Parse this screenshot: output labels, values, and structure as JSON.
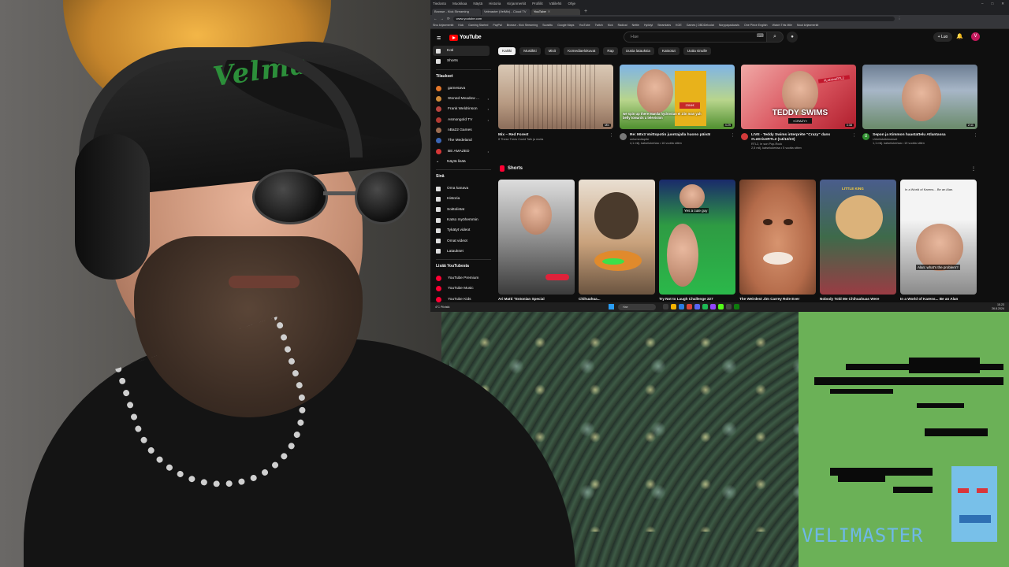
{
  "browser": {
    "menubar": [
      "Tiedosto",
      "Muokkaa",
      "Näytä",
      "Historia",
      "Kirjanmerkit",
      "Profiilit",
      "Välilehti",
      "Ohje"
    ],
    "tabs": [
      {
        "label": "Browse - Kick Streaming",
        "active": false
      },
      {
        "label": "Velmaster (VelMix) - Cloud TV",
        "active": false
      },
      {
        "label": "YouTube",
        "active": true
      }
    ],
    "new_tab": "+",
    "url": "www.youtube.com",
    "bookmarks": [
      "Sivu kirjanmerkit",
      "Kick",
      "Gaming Started",
      "PayPal",
      "Browse - Kick Streaming",
      "Suosittu",
      "Google Maps",
      "YouTube",
      "Twitch",
      "Kick",
      "Radical",
      "Nettie",
      "Hyödyt",
      "Steamlabs",
      "KOE",
      "Games | DBDDelcolat",
      "Norppapadcasts",
      "One Piece English",
      "Watch This Mile",
      "Muut kirjanmerkit"
    ]
  },
  "youtube": {
    "logo_text": "YouTube",
    "search_placeholder": "Hae",
    "create_label": "Luo",
    "avatar_letter": "V",
    "sidebar": {
      "main": [
        {
          "label": "Koti",
          "active": true
        },
        {
          "label": "Shorts",
          "active": false
        }
      ],
      "subscriptions_title": "Tilaukset",
      "subscriptions": [
        {
          "label": "gamesava",
          "color": "#e4772a"
        },
        {
          "label": "Stoned Meadow ...",
          "color": "#d08b3a"
        },
        {
          "label": "Frank Weldrinson",
          "color": "#b9453f"
        },
        {
          "label": "Asmongold TV",
          "color": "#b23a33"
        },
        {
          "label": "nBa22 Games",
          "color": "#9d6d52"
        },
        {
          "label": "The Medeland",
          "color": "#3b65b3"
        },
        {
          "label": "BE AMAZED",
          "color": "#d63737"
        }
      ],
      "show_more": "Näytä lisää",
      "you_title": "Sinä",
      "you": [
        {
          "label": "Oma kanava"
        },
        {
          "label": "Historia"
        },
        {
          "label": "Soittolistat"
        },
        {
          "label": "Katso myöhemmin"
        },
        {
          "label": "Tykätyt videot"
        },
        {
          "label": "Omat videot"
        },
        {
          "label": "Lataukset"
        }
      ],
      "more_title": "Lisää YouTubesta",
      "more": [
        {
          "label": "YouTube Premium",
          "color": "#ff0033"
        },
        {
          "label": "YouTube Music",
          "color": "#ff0033"
        },
        {
          "label": "YouTube Kids",
          "color": "#ff0033"
        }
      ]
    },
    "chips": [
      {
        "label": "Kaikki",
        "active": true
      },
      {
        "label": "Musiikki",
        "active": false
      },
      {
        "label": "Mixit",
        "active": false
      },
      {
        "label": "Komediaelokuvat",
        "active": false
      },
      {
        "label": "Rap",
        "active": false
      },
      {
        "label": "Uusia latauksia",
        "active": false
      },
      {
        "label": "Katsotut",
        "active": false
      },
      {
        "label": "Uutta sinulle",
        "active": false
      }
    ],
    "videos": [
      {
        "title": "Mix – Red Forest",
        "channel": "If These Trees Could Talk ja muita",
        "stats": "",
        "duration": "Mix",
        "avatar_color": "#555555"
      },
      {
        "title": "Re: Mtv3 Voittopotin juontajalla huono päivä!",
        "channel": "ontomediaprte",
        "stats": "4,1 milj. katselukertaa • 16 vuotta sitten",
        "duration": "4:29",
        "avatar_color": "#777777",
        "caption": "we spin up there Manila hydrostan ei ziin man yah belly towards a television",
        "price": "2304€"
      },
      {
        "title": "LIVE - Teddy Swims interprète \"Crazy\" dans #LeDriveRTL2 (14/12/23)",
        "channel": "RTL2, le son Pop-Rock",
        "stats": "2,5 milj. katselukertaa • 5 vuotta sitten",
        "duration": "3:38",
        "avatar_color": "#d23a3a",
        "tag": "#LeDriveRTL2",
        "overlay": "TEDDY SWIMS",
        "overlay_sub": "«CRAZY»"
      },
      {
        "title": "Sepon ja Kimmon haastattelu Atlantassa",
        "channel": "Urheilututkimukset",
        "stats": "1,1 milj. katselukertaa • 19 vuotta sitten",
        "duration": "2:11",
        "avatar_color": "#2f8f2f",
        "avatar_letter": "U"
      }
    ],
    "shorts_title": "Shorts",
    "shorts": [
      {
        "title": "Ari Matti \"Estonian Special"
      },
      {
        "title": "Chihuahua..."
      },
      {
        "title": "Try Not to Laugh Challenge 227",
        "overlay": "Yes a cute guy"
      },
      {
        "title": "The Weirdest Jim Carrey Role Ever"
      },
      {
        "title": "Nobody Told Me Chihuahuas Were",
        "overlay": "LITTLE KING"
      },
      {
        "title": "In a World of Karens... Be an Alan",
        "tweet": "In a World of Karens... Be an Alan.",
        "overlay": "Alan: what's the problem?"
      }
    ]
  },
  "taskbar": {
    "weather": "4°C Pilvistä",
    "search": "Hae",
    "time": "15.23",
    "date": "26.8.2024"
  },
  "webcam": {
    "cap_text": "Velma"
  },
  "game": {
    "brand": "VELIMASTER"
  }
}
